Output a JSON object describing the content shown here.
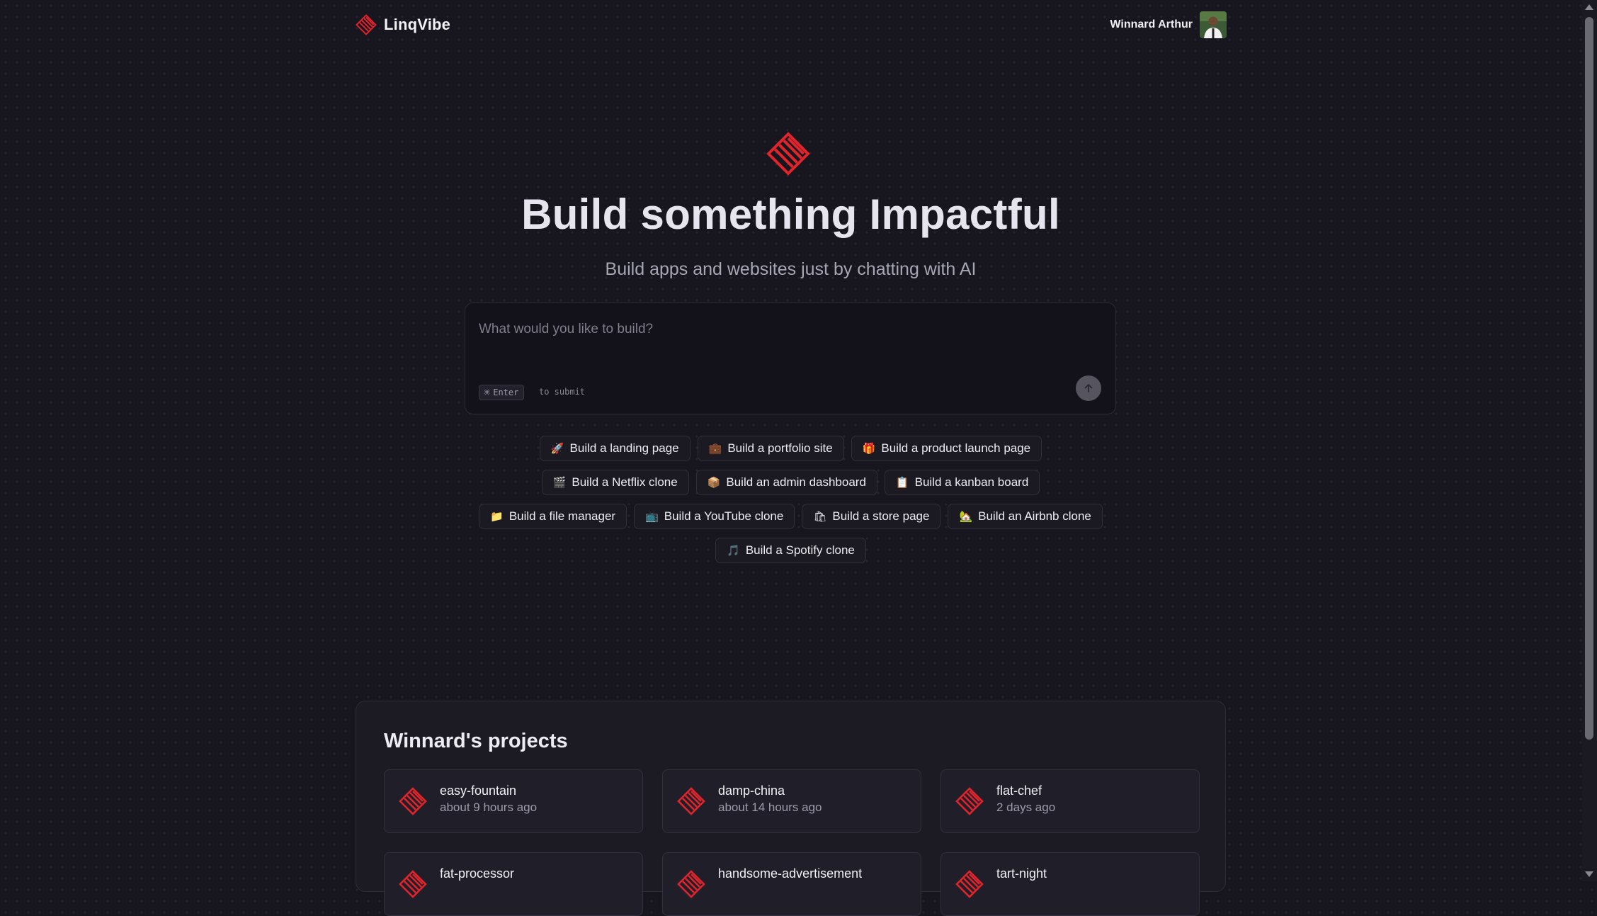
{
  "header": {
    "brand": "LinqVibe",
    "user_name": "Winnard Arthur"
  },
  "hero": {
    "title": "Build something Impactful",
    "subtitle": "Build apps and websites just by chatting with AI"
  },
  "prompt": {
    "placeholder": "What would you like to build?",
    "value": "",
    "shortcut_key": "Enter",
    "shortcut_symbol": "⌘",
    "shortcut_hint": "to submit"
  },
  "suggestions": [
    {
      "icon": "🚀",
      "label": "Build a landing page"
    },
    {
      "icon": "💼",
      "label": "Build a portfolio site"
    },
    {
      "icon": "🎁",
      "label": "Build a product launch page"
    },
    {
      "icon": "🎬",
      "label": "Build a Netflix clone"
    },
    {
      "icon": "📦",
      "label": "Build an admin dashboard"
    },
    {
      "icon": "📋",
      "label": "Build a kanban board"
    },
    {
      "icon": "📁",
      "label": "Build a file manager"
    },
    {
      "icon": "📺",
      "label": "Build a YouTube clone"
    },
    {
      "icon": "🛍",
      "label": "Build a store page"
    },
    {
      "icon": "🏡",
      "label": "Build an Airbnb clone"
    },
    {
      "icon": "🎵",
      "label": "Build a Spotify clone"
    }
  ],
  "projects": {
    "title": "Winnard's projects",
    "items": [
      {
        "name": "easy-fountain",
        "time": "about 9 hours ago"
      },
      {
        "name": "damp-china",
        "time": "about 14 hours ago"
      },
      {
        "name": "flat-chef",
        "time": "2 days ago"
      },
      {
        "name": "fat-processor",
        "time": ""
      },
      {
        "name": "handsome-advertisement",
        "time": ""
      },
      {
        "name": "tart-night",
        "time": ""
      }
    ]
  },
  "colors": {
    "accent": "#e0242b",
    "background": "#17161e",
    "panel": "#1c1b24"
  }
}
